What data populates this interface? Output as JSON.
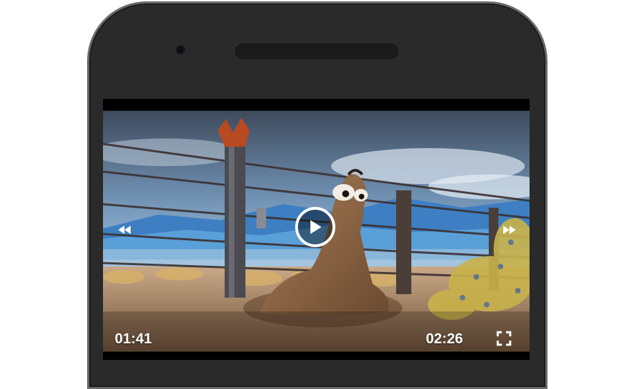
{
  "player": {
    "current_time": "01:41",
    "total_time": "02:26",
    "state": "paused"
  },
  "icons": {
    "play": "play-icon",
    "rewind": "rewind-icon",
    "fast_forward": "fast-forward-icon",
    "fullscreen": "fullscreen-icon"
  },
  "colors": {
    "phone_body": "#2a2a2a",
    "phone_rim": "#6a6a6a",
    "controls": "#ffffff"
  }
}
